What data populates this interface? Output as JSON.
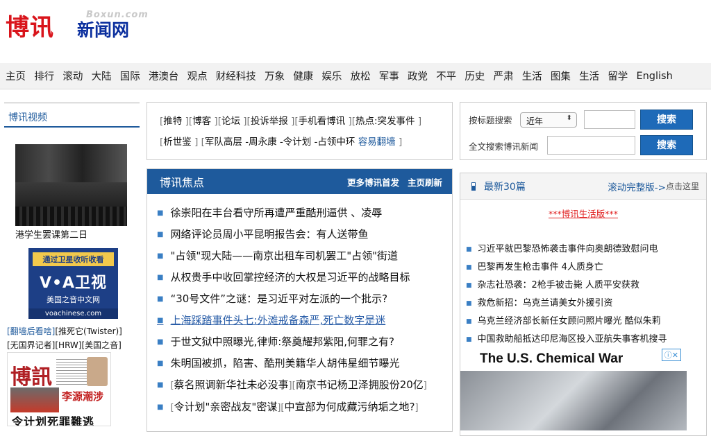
{
  "logo": {
    "big": "博讯",
    "small": "新闻网",
    "domain": "Boxun.com"
  },
  "nav": [
    "主页",
    "排行",
    "滚动",
    "大陆",
    "国际",
    "港澳台",
    "观点",
    "财经科技",
    "万象",
    "健康",
    "娱乐",
    "放松",
    "军事",
    "政党",
    "不平",
    "历史",
    "严肃",
    "生活",
    "图集",
    "生活",
    "留学",
    "English"
  ],
  "left": {
    "header": "博讯视频",
    "video_caption": "港学生罢课第二日",
    "voa": {
      "top": "通过卫星收听收看",
      "logo": "V•A卫视",
      "sub": "美国之音中文网",
      "url": "voachinese.com"
    },
    "links_line1_blue": "[翻墙后看啥]",
    "links_line1": "[推死它(Twister)]",
    "links_line2": "[无国界记者][HRW][美国之音]",
    "magazine": {
      "title": "博訊",
      "red": "李源潮涉",
      "bottom": "令计划死罪難逃"
    }
  },
  "topbox": {
    "line1": [
      {
        "b1": "[",
        "t": "推特",
        "b2": " ]"
      },
      {
        "b1": "[",
        "t": "博客",
        "b2": " ]"
      },
      {
        "b1": "[",
        "t": "论坛",
        "b2": " ]"
      },
      {
        "b1": "[",
        "t": "投诉举报",
        "b2": " ]"
      },
      {
        "b1": "[",
        "t": "手机看博讯",
        "b2": " ]"
      },
      {
        "b1": "[",
        "t": "热点:突发事件",
        "b2": " ]"
      }
    ],
    "line2_a": "[",
    "line2_b": "析世鉴",
    "line2_c": " ] [",
    "line2_d": "军队高层 -周永康 -令计划 -占领中环 ",
    "line2_blue": "容易翻墙",
    "line2_e": " ]"
  },
  "focus": {
    "title": "博讯焦点",
    "more": "更多博讯首发",
    "refresh": "主页刷新",
    "items": [
      "徐崇阳在丰台看守所再遭严重酷刑逼供 、凌辱",
      "网络评论员周小平昆明报告会：有人送带鱼",
      "\"占领\"现大陆——南京出租车司机罢工\"占领\"街道",
      "从权贵手中收回掌控经济的大权是习近平的战略目标",
      "“30号文件”之谜：是习近平对左派的一个批示?",
      "上海踩踏事件头七:外滩戒备森严,死亡数字是迷",
      "于世文狱中照曝光,律师:祭奠耀邦紫阳,何罪之有?",
      "朱明国被抓，陷害、酷刑美籍华人胡伟星细节曝光"
    ],
    "item9": {
      "a": "[",
      "b": "蔡名照调新华社未必没事",
      "c": "][",
      "d": "南京书记杨卫泽拥股份20亿",
      "e": "]"
    },
    "item10": {
      "a": "[",
      "b": "令计划\"亲密战友\"密谋",
      "c": "][",
      "d": "中宣部为何成藏污纳垢之地?",
      "e": "]"
    }
  },
  "search": {
    "title_label": "按标题搜索",
    "select_value": "近年",
    "full_label": "全文搜索博讯新闻",
    "button": "搜索"
  },
  "latest": {
    "title": "最新30篇",
    "full": "滚动完整版->",
    "click": "点击这里",
    "life": "***博讯生活版***",
    "items": [
      "习近平就巴黎恐怖袭击事件向奥朗德致慰问电",
      "巴黎再发生枪击事件 4人质身亡",
      "杂志社恐袭：2枪手被击毙 人质平安获救",
      "救危新招：乌克兰请美女外援引资",
      "乌克兰经济部长新任女顾问照片曝光 酷似朱莉",
      "中国救助船抵达印尼海区投入亚航失事客机搜寻"
    ],
    "ad_title": "The U.S. Chemical War",
    "ad_close": "ⓘ✕"
  }
}
